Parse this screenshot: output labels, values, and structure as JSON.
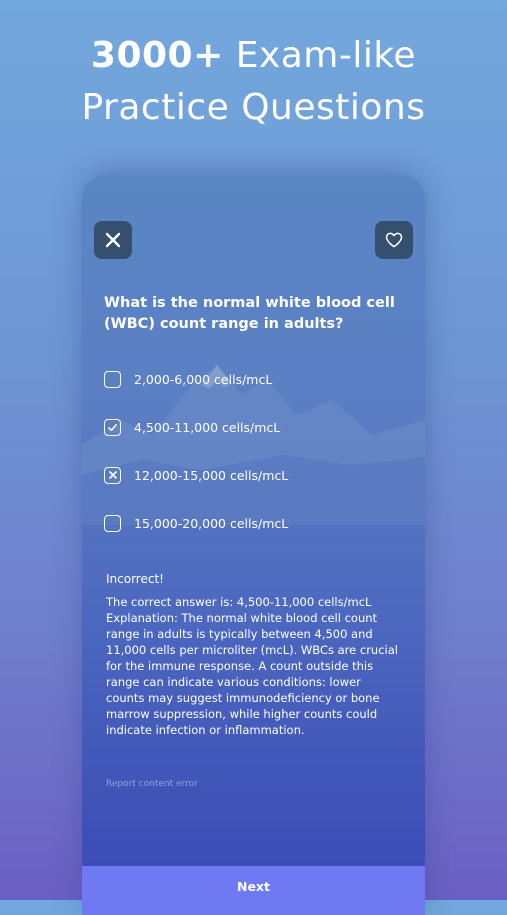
{
  "headline": {
    "line1_bold": "3000+",
    "line1_rest": " Exam-like",
    "line2": "Practice Questions"
  },
  "question": {
    "text": "What is the normal white blood cell (WBC) count range in adults?"
  },
  "options": [
    {
      "label": "2,000-6,000 cells/mcL",
      "state": "unselected"
    },
    {
      "label": "4,500-11,000 cells/mcL",
      "state": "correct"
    },
    {
      "label": "12,000-15,000 cells/mcL",
      "state": "wrong"
    },
    {
      "label": "15,000-20,000 cells/mcL",
      "state": "unselected"
    }
  ],
  "feedback": {
    "result": "Incorrect!",
    "explanation": "The correct answer is: 4,500-11,000 cells/mcL Explanation: The normal white blood cell count range in adults is typically between 4,500 and 11,000 cells per microliter (mcL). WBCs are crucial for the immune response. A count outside this range can indicate various conditions: lower counts may suggest immunodeficiency or bone marrow suppression, while higher counts could indicate infection or inflammation."
  },
  "report_link": "Report content error",
  "next_button": "Next",
  "icons": {
    "close": "close-icon",
    "favorite": "heart-icon",
    "checkmark": "checkmark-icon",
    "cross": "cross-icon"
  },
  "colors": {
    "button_bg": "#34506e",
    "next_bg": "#6f79f2",
    "report_link": "#8fa3d9"
  }
}
